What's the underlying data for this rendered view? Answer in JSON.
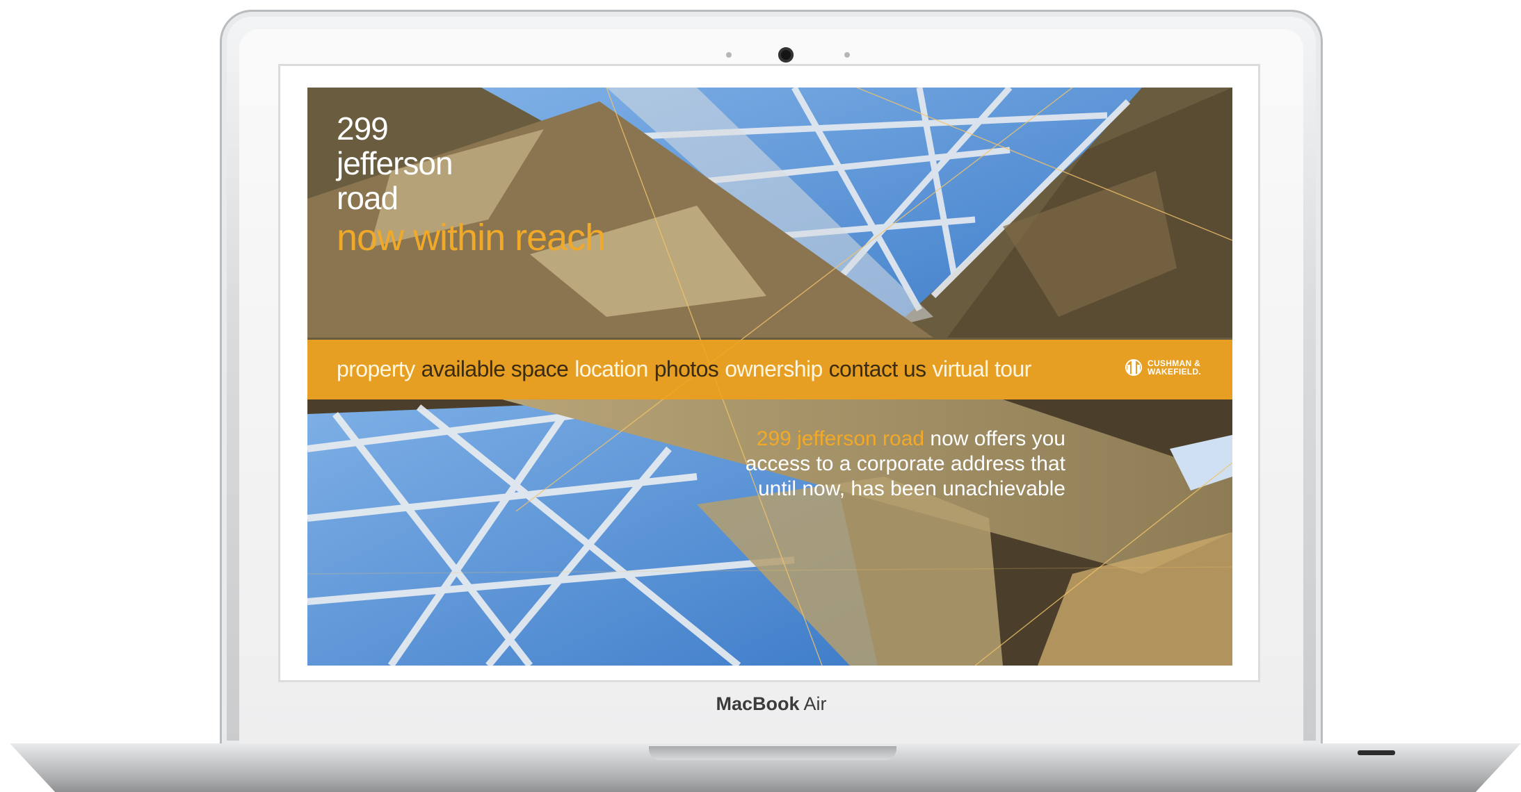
{
  "device": {
    "brand_bold": "MacBook",
    "brand_light": "Air"
  },
  "site": {
    "title_lines": [
      "299",
      "jefferson",
      "road"
    ],
    "tagline": "now within reach",
    "nav": [
      {
        "label": "property",
        "tone": "light"
      },
      {
        "label": "available space",
        "tone": "dark"
      },
      {
        "label": "location",
        "tone": "light"
      },
      {
        "label": "photos",
        "tone": "dark"
      },
      {
        "label": "ownership",
        "tone": "light"
      },
      {
        "label": "contact us",
        "tone": "dark"
      },
      {
        "label": "virtual tour",
        "tone": "light"
      }
    ],
    "logo": {
      "line1": "CUSHMAN &",
      "line2": "WAKEFIELD."
    },
    "intro": {
      "highlight": "299 jefferson road",
      "rest": " now offers you access to a corporate address that until now, has been unachievable"
    }
  },
  "colors": {
    "accent": "#f0a928",
    "nav_bar": "#f1a521",
    "dark_text": "#3b2b10"
  }
}
